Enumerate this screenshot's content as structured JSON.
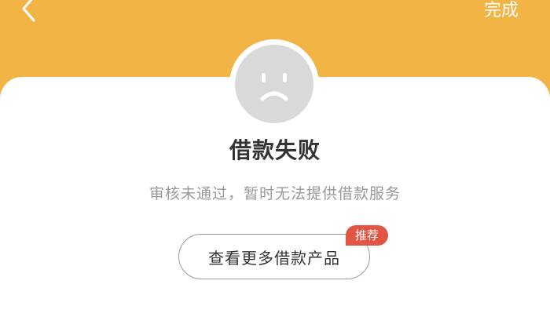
{
  "header": {
    "done_label": "完成"
  },
  "result": {
    "icon": "sad-face-icon",
    "title": "借款失败",
    "message": "审核未通过，暂时无法提供借款服务"
  },
  "action": {
    "more_products_label": "查看更多借款产品",
    "badge_label": "推荐"
  },
  "colors": {
    "header_bg": "#F2B445",
    "badge_bg": "#E25444",
    "avatar_bg": "#D9D9D9"
  }
}
